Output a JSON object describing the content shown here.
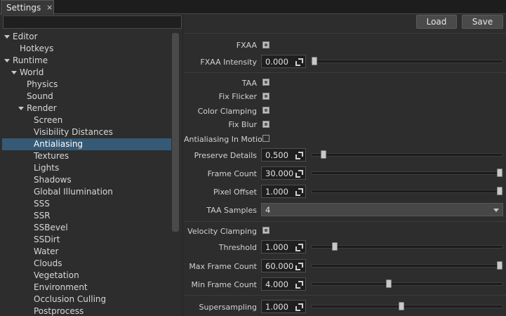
{
  "tab": {
    "title": "Settings",
    "close_glyph": "×"
  },
  "search": {
    "placeholder": ""
  },
  "tree": {
    "items": [
      {
        "label": "Editor",
        "expanded": true
      },
      {
        "label": "Hotkeys"
      },
      {
        "label": "Runtime",
        "expanded": true
      },
      {
        "label": "World",
        "expanded": true
      },
      {
        "label": "Physics"
      },
      {
        "label": "Sound"
      },
      {
        "label": "Render",
        "expanded": true
      },
      {
        "label": "Screen"
      },
      {
        "label": "Visibility Distances"
      },
      {
        "label": "Antialiasing",
        "selected": true
      },
      {
        "label": "Textures"
      },
      {
        "label": "Lights"
      },
      {
        "label": "Shadows"
      },
      {
        "label": "Global Illumination"
      },
      {
        "label": "SSS"
      },
      {
        "label": "SSR"
      },
      {
        "label": "SSBevel"
      },
      {
        "label": "SSDirt"
      },
      {
        "label": "Water"
      },
      {
        "label": "Clouds"
      },
      {
        "label": "Vegetation"
      },
      {
        "label": "Environment"
      },
      {
        "label": "Occlusion Culling"
      },
      {
        "label": "Postprocess"
      }
    ]
  },
  "toolbar": {
    "load_label": "Load",
    "save_label": "Save"
  },
  "settings": {
    "fxaa": {
      "label": "FXAA",
      "checked": true
    },
    "fxaa_intensity": {
      "label": "FXAA Intensity",
      "value": "0.000",
      "slider_fraction": 0.0
    },
    "taa": {
      "label": "TAA",
      "checked": true
    },
    "fix_flicker": {
      "label": "Fix Flicker",
      "checked": true
    },
    "color_clamping": {
      "label": "Color Clamping",
      "checked": true
    },
    "fix_blur": {
      "label": "Fix Blur",
      "checked": true
    },
    "antialiasing_in_motion": {
      "label": "Antialiasing In Motion",
      "checked": false
    },
    "preserve_details": {
      "label": "Preserve Details",
      "value": "0.500",
      "slider_fraction": 0.05
    },
    "frame_count": {
      "label": "Frame Count",
      "value": "30.000",
      "slider_fraction": 1.0
    },
    "pixel_offset": {
      "label": "Pixel Offset",
      "value": "1.000",
      "slider_fraction": 1.0
    },
    "taa_samples": {
      "label": "TAA Samples",
      "value": "4"
    },
    "velocity_clamping": {
      "label": "Velocity Clamping",
      "checked": true
    },
    "threshold": {
      "label": "Threshold",
      "value": "1.000",
      "slider_fraction": 0.11
    },
    "max_frame_count": {
      "label": "Max Frame Count",
      "value": "60.000",
      "slider_fraction": 1.0
    },
    "min_frame_count": {
      "label": "Min Frame Count",
      "value": "4.000",
      "slider_fraction": 0.4
    },
    "supersampling": {
      "label": "Supersampling",
      "value": "1.000",
      "slider_fraction": 0.47
    }
  }
}
